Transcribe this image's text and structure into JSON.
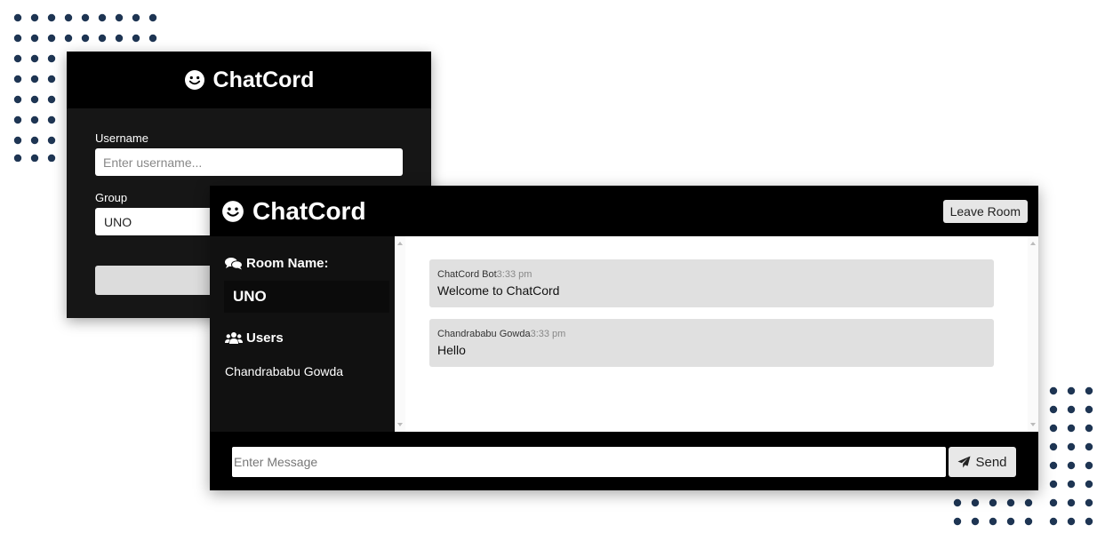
{
  "join": {
    "title": "ChatCord",
    "username_label": "Username",
    "username_placeholder": "Enter username...",
    "group_label": "Group",
    "group_value": "UNO"
  },
  "chat": {
    "title": "ChatCord",
    "leave_label": "Leave Room",
    "room_heading": "Room Name:",
    "room_name": "UNO",
    "users_heading": "Users",
    "users": [
      "Chandrababu Gowda"
    ],
    "messages": [
      {
        "user": "ChatCord Bot",
        "time": "3:33 pm",
        "text": "Welcome to ChatCord"
      },
      {
        "user": "Chandrababu Gowda",
        "time": "3:33 pm",
        "text": "Hello"
      }
    ],
    "message_placeholder": "Enter Message",
    "send_label": "Send"
  },
  "colors": {
    "dots": "#1e3553",
    "header": "#000000",
    "panel": "#161616",
    "message_bg": "#e0e0e0"
  },
  "icons": {
    "logo": "smile-icon",
    "room": "comments-icon",
    "users": "users-icon",
    "send": "paper-plane-icon"
  }
}
